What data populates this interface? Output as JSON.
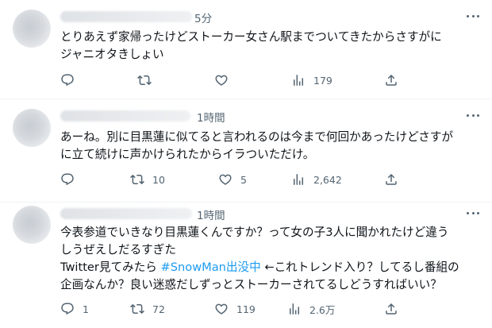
{
  "tweets": [
    {
      "time": "5分",
      "lines": [
        "とりあえず家帰ったけどストーカー女さん駅までついてきたからさすがに",
        "ジャニオタきしょい"
      ],
      "replies": "",
      "retweets": "",
      "likes": "",
      "views": "179"
    },
    {
      "time": "1時間",
      "lines": [
        "あーね。別に目黒蓮に似てると言われるのは今まで何回かあったけどさすが",
        "に立て続けに声かけられたからイラついただけ。"
      ],
      "replies": "",
      "retweets": "10",
      "likes": "5",
      "views": "2,642"
    },
    {
      "time": "1時間",
      "lines": [
        "今表参道でいきなり目黒蓮くんですか？って女の子3人に聞かれたけど違う",
        "しうぜえしだるすぎた"
      ],
      "line3_before": "Twitter見てみたら ",
      "line3_hashtag": "#SnowMan出没中",
      "line3_after": " ←これトレンド入り？してるし番組の",
      "line4": "企画なんか？良い迷惑だしずっとストーカーされてるしどうすればいい？",
      "replies": "1",
      "retweets": "72",
      "likes": "119",
      "views": "2.6万"
    }
  ],
  "icons": {
    "reply": "speech-bubble-icon",
    "retweet": "retweet-arrows-icon",
    "like": "heart-icon",
    "views": "bar-chart-icon",
    "share": "share-upload-icon",
    "more": "more-dots-icon"
  },
  "colors": {
    "text": "#0f1419",
    "secondary": "#536471",
    "hashtag": "#1d9bf0",
    "divider": "#eff3f4"
  }
}
